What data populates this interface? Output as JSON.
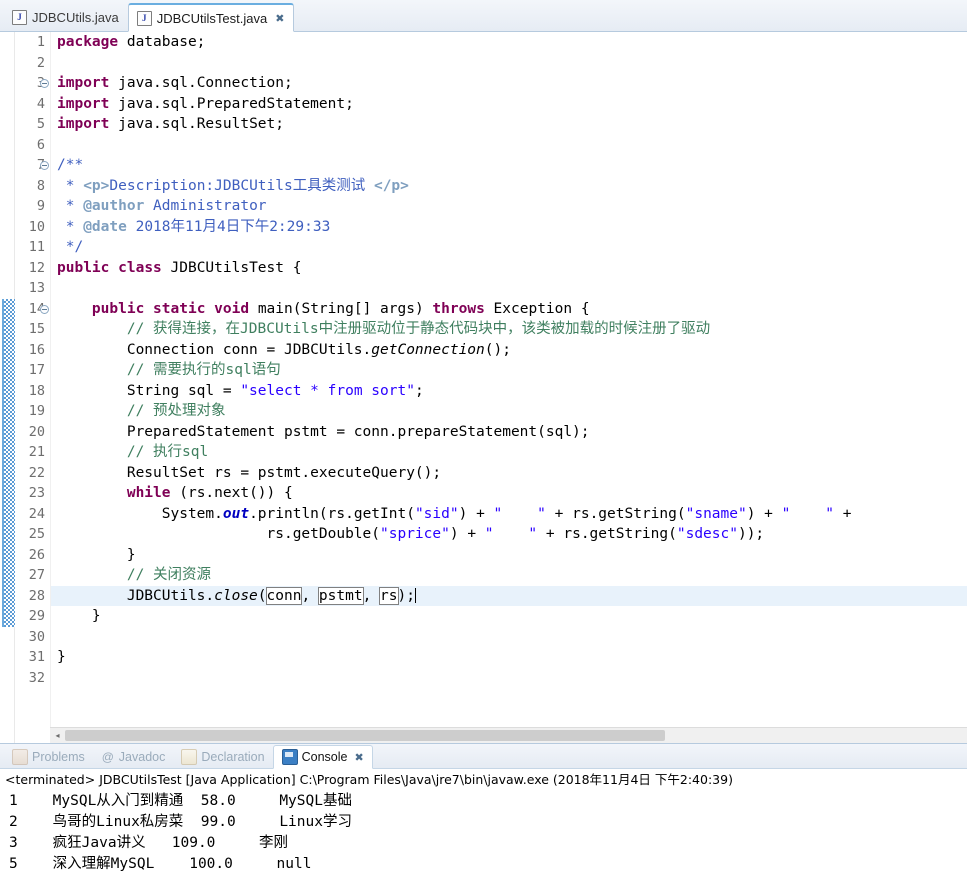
{
  "editor": {
    "tabs": [
      {
        "label": "JDBCUtils.java",
        "icon": "java-file-icon",
        "active": false,
        "closable": false
      },
      {
        "label": "JDBCUtilsTest.java",
        "icon": "java-file-icon",
        "active": true,
        "closable": true
      }
    ],
    "close_glyph": "✖",
    "java_icon_glyph": "J",
    "current_line": 28,
    "changed_lines": {
      "from": 14,
      "to": 29
    },
    "lines": [
      {
        "n": "1",
        "fold": false
      },
      {
        "n": "2",
        "fold": false
      },
      {
        "n": "3",
        "fold": true
      },
      {
        "n": "4",
        "fold": false
      },
      {
        "n": "5",
        "fold": false
      },
      {
        "n": "6",
        "fold": false
      },
      {
        "n": "7",
        "fold": true
      },
      {
        "n": "8",
        "fold": false
      },
      {
        "n": "9",
        "fold": false
      },
      {
        "n": "10",
        "fold": false
      },
      {
        "n": "11",
        "fold": false
      },
      {
        "n": "12",
        "fold": false
      },
      {
        "n": "13",
        "fold": false
      },
      {
        "n": "14",
        "fold": true
      },
      {
        "n": "15",
        "fold": false
      },
      {
        "n": "16",
        "fold": false
      },
      {
        "n": "17",
        "fold": false
      },
      {
        "n": "18",
        "fold": false
      },
      {
        "n": "19",
        "fold": false
      },
      {
        "n": "20",
        "fold": false
      },
      {
        "n": "21",
        "fold": false
      },
      {
        "n": "22",
        "fold": false
      },
      {
        "n": "23",
        "fold": false
      },
      {
        "n": "24",
        "fold": false
      },
      {
        "n": "25",
        "fold": false
      },
      {
        "n": "26",
        "fold": false
      },
      {
        "n": "27",
        "fold": false
      },
      {
        "n": "28",
        "fold": false
      },
      {
        "n": "29",
        "fold": false
      },
      {
        "n": "30",
        "fold": false
      },
      {
        "n": "31",
        "fold": false
      },
      {
        "n": "32",
        "fold": false
      }
    ],
    "source": [
      "package database;",
      "",
      "import java.sql.Connection;",
      "import java.sql.PreparedStatement;",
      "import java.sql.ResultSet;",
      "",
      "/**",
      " * <p>Description:JDBCUtils工具类测试 </p>",
      " * @author Administrator",
      " * @date 2018年11月4日下午2:29:33",
      " */",
      "public class JDBCUtilsTest {",
      "",
      "    public static void main(String[] args) throws Exception {",
      "        // 获得连接，在JDBCUtils中注册驱动位于静态代码块中，该类被加载的时候注册了驱动",
      "        Connection conn = JDBCUtils.getConnection();",
      "        // 需要执行的sql语句",
      "        String sql = \"select * from sort\";",
      "        // 预处理对象",
      "        PreparedStatement pstmt = conn.prepareStatement(sql);",
      "        // 执行sql",
      "        ResultSet rs = pstmt.executeQuery();",
      "        while (rs.next()) {",
      "            System.out.println(rs.getInt(\"sid\") + \"    \" + rs.getString(\"sname\") + \"    \" +",
      "                        rs.getDouble(\"sprice\") + \"    \" + rs.getString(\"sdesc\"));",
      "        }",
      "        // 关闭资源",
      "        JDBCUtils.close(conn, pstmt, rs);",
      "    }",
      "",
      "}",
      ""
    ],
    "hscroll": {
      "left_arrow": "◂",
      "right_arrow": "▸"
    }
  },
  "console": {
    "tabs": [
      {
        "label": "Problems",
        "icon": "problems-icon",
        "active": false,
        "closable": false
      },
      {
        "label": "Javadoc",
        "icon": "javadoc-icon",
        "active": false,
        "closable": false
      },
      {
        "label": "Declaration",
        "icon": "declaration-icon",
        "active": false,
        "closable": false
      },
      {
        "label": "Console",
        "icon": "console-icon",
        "active": true,
        "closable": true
      }
    ],
    "close_glyph": "✖",
    "javadoc_glyph": "@",
    "terminated_line": "<terminated> JDBCUtilsTest [Java Application] C:\\Program Files\\Java\\jre7\\bin\\javaw.exe (2018年11月4日 下午2:40:39)",
    "output_rows": [
      {
        "sid": "1",
        "sname": "MySQL从入门到精通",
        "sprice": "58.0",
        "sdesc": "MySQL基础"
      },
      {
        "sid": "2",
        "sname": "鸟哥的Linux私房菜",
        "sprice": "99.0",
        "sdesc": "Linux学习"
      },
      {
        "sid": "3",
        "sname": "疯狂Java讲义",
        "sprice": "109.0",
        "sdesc": "李刚"
      },
      {
        "sid": "5",
        "sname": "深入理解MySQL",
        "sprice": "100.0",
        "sdesc": "null"
      }
    ],
    "output_text": [
      "1    MySQL从入门到精通  58.0     MySQL基础",
      "2    鸟哥的Linux私房菜  99.0     Linux学习",
      "3    疯狂Java讲义   109.0     李刚",
      "5    深入理解MySQL    100.0     null"
    ]
  },
  "colors": {
    "keyword": "#7f0055",
    "string": "#2a00ff",
    "comment": "#3f7f5f",
    "javadoc": "#3f5fbf",
    "javadoc_tag": "#7f9fbf",
    "static_field": "#0000c0",
    "current_line_bg": "#e8f2fb",
    "change_bar": "#5b9bd5",
    "tab_active_top": "#6aaee0"
  }
}
